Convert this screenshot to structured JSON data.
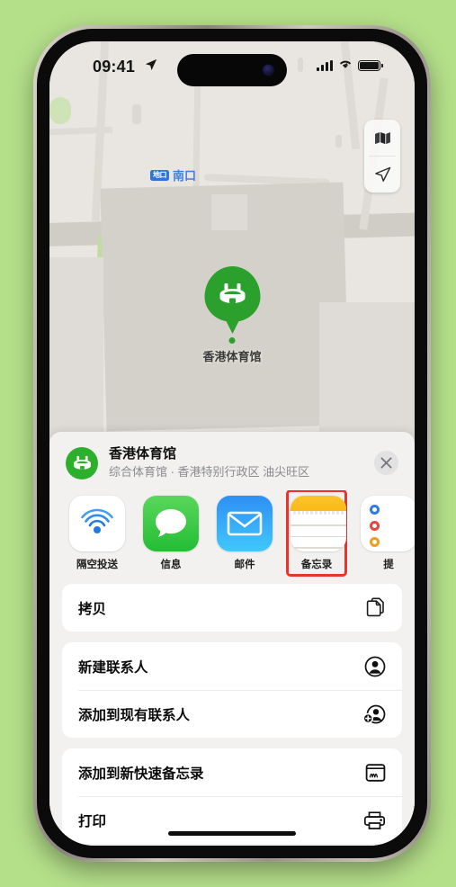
{
  "status_bar": {
    "time": "09:41",
    "location_arrow_icon": "location-arrow-icon",
    "signal_icon": "cellular-signal-icon",
    "wifi_icon": "wifi-icon",
    "battery_icon": "battery-icon"
  },
  "map": {
    "transit_badge": "地口",
    "transit_label": "南口",
    "pin_label": "香港体育馆",
    "pin_color": "#2ca02c",
    "controls": [
      {
        "name": "map-layers-icon"
      },
      {
        "name": "location-arrow-icon"
      }
    ]
  },
  "share_sheet": {
    "place_title": "香港体育馆",
    "place_subtitle": "综合体育馆 · 香港特别行政区 油尖旺区",
    "place_icon": "stadium-icon",
    "close_icon": "close-icon",
    "apps": [
      {
        "label": "隔空投送",
        "icon": "airdrop-icon"
      },
      {
        "label": "信息",
        "icon": "messages-icon"
      },
      {
        "label": "邮件",
        "icon": "mail-icon"
      },
      {
        "label": "备忘录",
        "icon": "notes-icon",
        "highlighted": true
      },
      {
        "label": "提",
        "icon": "reminders-icon"
      }
    ],
    "highlight_color": "#e8342a",
    "actions": [
      {
        "label": "拷贝",
        "icon": "copy-icon"
      },
      {
        "label": "新建联系人",
        "icon": "new-contact-icon"
      },
      {
        "label": "添加到现有联系人",
        "icon": "add-existing-contact-icon"
      },
      {
        "label": "添加到新快速备忘录",
        "icon": "quick-note-icon"
      },
      {
        "label": "打印",
        "icon": "printer-icon"
      }
    ]
  }
}
